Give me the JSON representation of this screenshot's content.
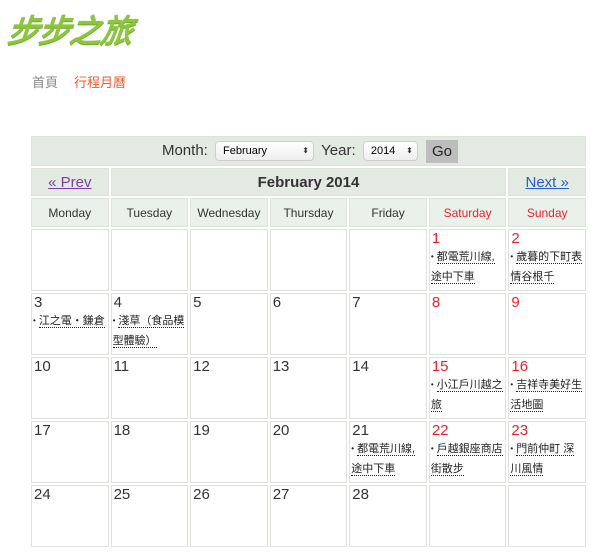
{
  "site": {
    "logo_text": "步步之旅",
    "brand_color": "#8cc63f"
  },
  "breadcrumb": {
    "home": "首頁",
    "current": "行程月曆",
    "current_color": "#f15a29"
  },
  "controls": {
    "month_label": "Month:",
    "month_value": "February",
    "year_label": "Year:",
    "year_value": "2014",
    "go_label": "Go"
  },
  "nav": {
    "prev": "« Prev",
    "title": "February 2014",
    "next": "Next »"
  },
  "weekdays": [
    "Monday",
    "Tuesday",
    "Wednesday",
    "Thursday",
    "Friday",
    "Saturday",
    "Sunday"
  ],
  "weekend_color": "#e8232a",
  "weeks": [
    [
      {
        "day": ""
      },
      {
        "day": ""
      },
      {
        "day": ""
      },
      {
        "day": ""
      },
      {
        "day": ""
      },
      {
        "day": "1",
        "events": [
          "都電荒川線, 途中下車"
        ]
      },
      {
        "day": "2",
        "events": [
          "歲暮的下町表情谷根千"
        ]
      }
    ],
    [
      {
        "day": "3",
        "events": [
          "江之電・鎌倉"
        ]
      },
      {
        "day": "4",
        "events": [
          "淺草（食品模型體驗）"
        ]
      },
      {
        "day": "5"
      },
      {
        "day": "6"
      },
      {
        "day": "7"
      },
      {
        "day": "8"
      },
      {
        "day": "9"
      }
    ],
    [
      {
        "day": "10"
      },
      {
        "day": "11"
      },
      {
        "day": "12"
      },
      {
        "day": "13"
      },
      {
        "day": "14"
      },
      {
        "day": "15",
        "events": [
          "小江戶川越之旅"
        ]
      },
      {
        "day": "16",
        "events": [
          "吉祥寺美好生活地圖"
        ]
      }
    ],
    [
      {
        "day": "17"
      },
      {
        "day": "18"
      },
      {
        "day": "19"
      },
      {
        "day": "20"
      },
      {
        "day": "21",
        "events": [
          "都電荒川線, 途中下車"
        ]
      },
      {
        "day": "22",
        "events": [
          "戶越銀座商店街散步"
        ]
      },
      {
        "day": "23",
        "events": [
          "門前仲町 深川風情"
        ]
      }
    ],
    [
      {
        "day": "24"
      },
      {
        "day": "25"
      },
      {
        "day": "26"
      },
      {
        "day": "27"
      },
      {
        "day": "28"
      },
      {
        "day": ""
      },
      {
        "day": ""
      }
    ]
  ]
}
